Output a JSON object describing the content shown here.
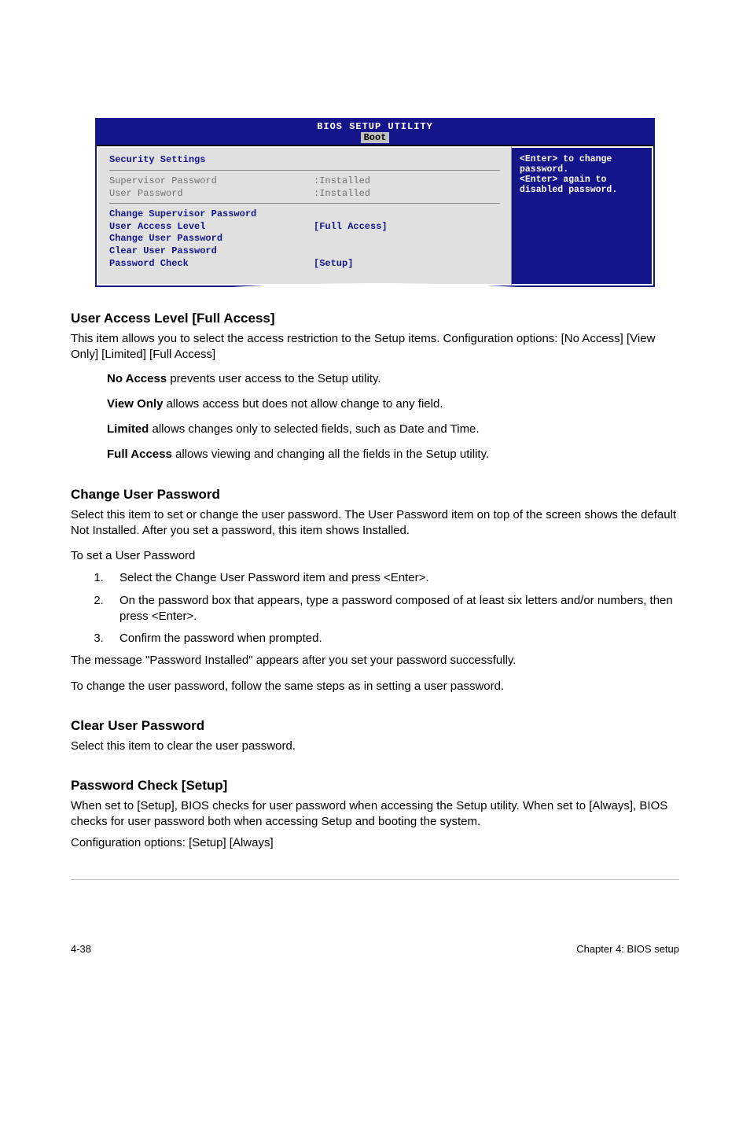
{
  "bios": {
    "header": "BIOS SETUP UTILITY",
    "tab": "Boot",
    "sectionTitle": "Security Settings",
    "rows": {
      "supervisorLabel": "Supervisor Password",
      "supervisorVal": ":Installed",
      "userLabel": "User Password",
      "userVal": ":Installed",
      "changeSup": "Change Supervisor Password",
      "ualLabel": "User Access Level",
      "ualVal": "[Full Access]",
      "changeUser": "Change User Password",
      "clearUser": "Clear User Password",
      "pwCheckLabel": "Password Check",
      "pwCheckVal": "[Setup]"
    },
    "help": {
      "l1": "<Enter> to change",
      "l2": "password.",
      "l3": "<Enter> again to",
      "l4": "disabled password."
    }
  },
  "sections": {
    "ual": {
      "title": "User Access Level [Full Access]",
      "p1": "This item allows you to select the access restriction to the Setup items. Configuration options: [No Access] [View Only] [Limited] [Full Access]",
      "noAccessB": "No Access",
      "noAccessT": " prevents user access to the Setup utility.",
      "viewOnlyB": "View Only",
      "viewOnlyT": " allows access but does not allow change to any field.",
      "limitedB": "Limited",
      "limitedT": " allows changes only to selected fields, such as Date and Time.",
      "fullAccessB": "Full Access",
      "fullAccessT": " allows viewing and changing all the fields in the Setup utility."
    },
    "cup": {
      "title": "Change User Password",
      "p1": "Select this item to set or change the user password. The User Password item on top of the screen shows the default Not Installed. After you set a password, this item shows Installed.",
      "p2": "To set a User Password",
      "step1": "Select the Change User Password item and press <Enter>.",
      "step2": "On the password box that appears, type a password composed of at least six letters and/or numbers, then press <Enter>.",
      "step3": "Confirm the password when prompted.",
      "p3": "The message \"Password Installed\" appears after you set your password successfully.",
      "p4": "To change the user password, follow the same steps as in setting a user password."
    },
    "clr": {
      "title": "Clear User Password",
      "p1": "Select this item to clear the user password."
    },
    "pwc": {
      "title": "Password Check [Setup]",
      "p1": "When set to [Setup], BIOS checks for user password when accessing the Setup utility. When set to [Always], BIOS checks for user password both when accessing Setup and booting the system.",
      "p2": "Configuration options: [Setup] [Always]"
    }
  },
  "footer": {
    "left": "4-38",
    "right": "Chapter 4: BIOS setup"
  }
}
